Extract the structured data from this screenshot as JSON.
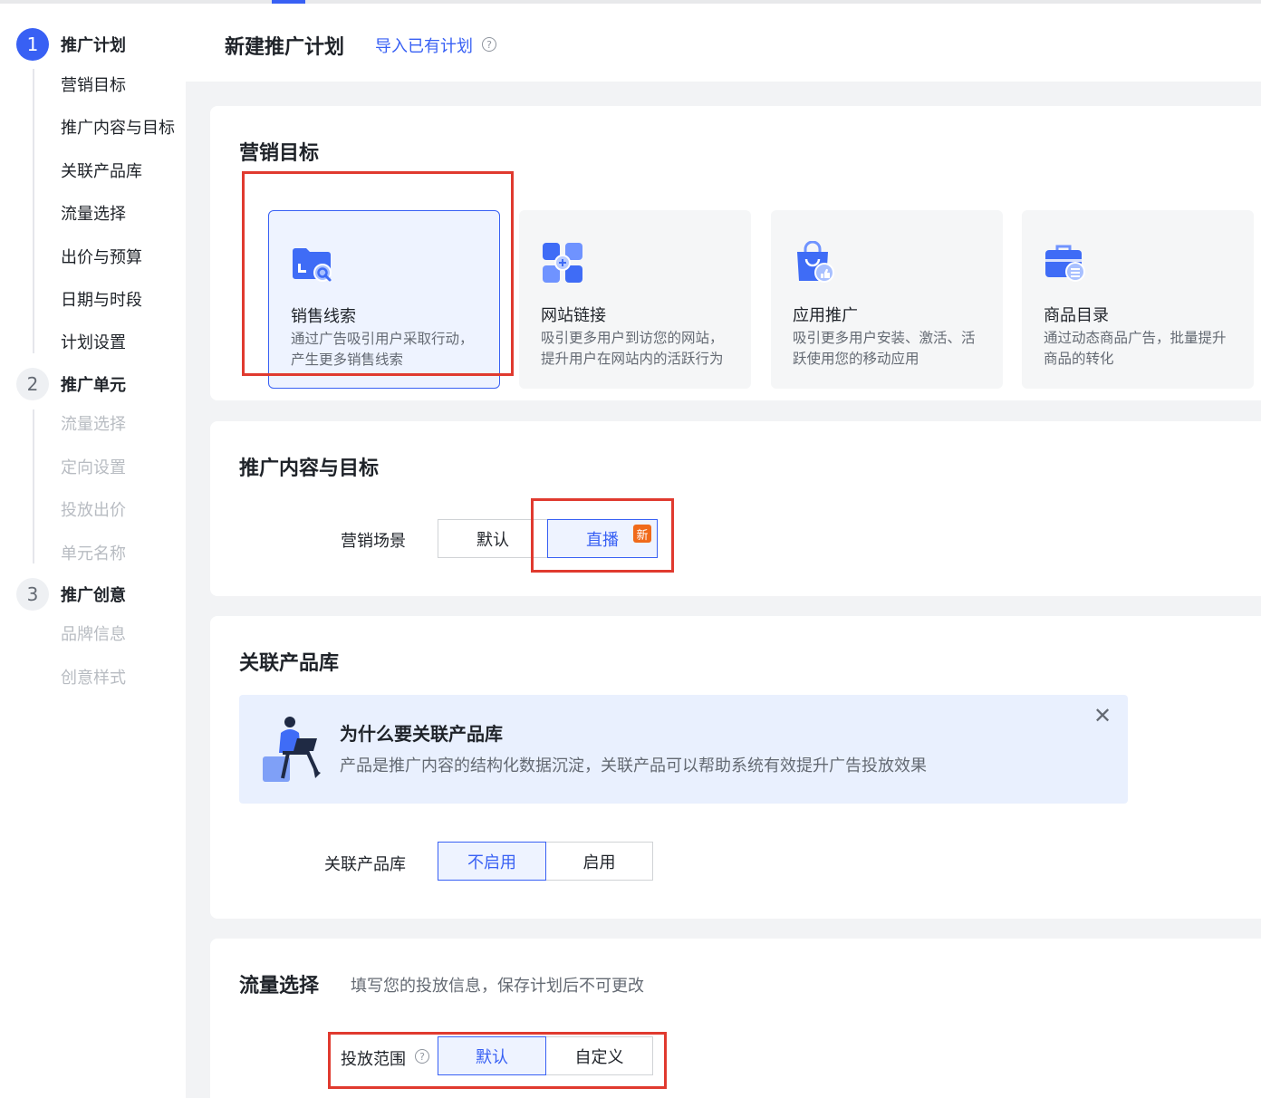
{
  "sidebar": {
    "steps": [
      {
        "number": "1",
        "title": "推广计划",
        "items": [
          "营销目标",
          "推广内容与目标",
          "关联产品库",
          "流量选择",
          "出价与预算",
          "日期与时段",
          "计划设置"
        ]
      },
      {
        "number": "2",
        "title": "推广单元",
        "items": [
          "流量选择",
          "定向设置",
          "投放出价",
          "单元名称"
        ]
      },
      {
        "number": "3",
        "title": "推广创意",
        "items": [
          "品牌信息",
          "创意样式"
        ]
      }
    ]
  },
  "header": {
    "title": "新建推广计划",
    "import_link": "导入已有计划",
    "help_glyph": "?"
  },
  "marketing_goal": {
    "title": "营销目标",
    "options": [
      {
        "title": "销售线索",
        "desc": "通过广告吸引用户采取行动，产生更多销售线索",
        "icon": "folder-search-icon"
      },
      {
        "title": "网站链接",
        "desc": "吸引更多用户到访您的网站，提升用户在网站内的活跃行为",
        "icon": "link-blocks-icon"
      },
      {
        "title": "应用推广",
        "desc": "吸引更多用户安装、激活、活跃使用您的移动应用",
        "icon": "shopping-bag-thumb-icon"
      },
      {
        "title": "商品目录",
        "desc": "通过动态商品广告，批量提升商品的转化",
        "icon": "briefcase-list-icon"
      }
    ]
  },
  "content_goal": {
    "title": "推广内容与目标",
    "scene_label": "营销场景",
    "option_default": "默认",
    "option_live": "直播",
    "badge_new": "新"
  },
  "product_lib": {
    "title": "关联产品库",
    "banner_title": "为什么要关联产品库",
    "banner_text": "产品是推广内容的结构化数据沉淀，关联产品可以帮助系统有效提升广告投放效果",
    "close_glyph": "✕",
    "label": "关联产品库",
    "option_off": "不启用",
    "option_on": "启用"
  },
  "traffic": {
    "title": "流量选择",
    "desc": "填写您的投放信息，保存计划后不可更改",
    "range_label": "投放范围",
    "option_default": "默认",
    "option_custom": "自定义"
  },
  "colors": {
    "accent": "#3860f4",
    "highlight_red": "#e03a2f",
    "badge_orange": "#f06a1a"
  }
}
